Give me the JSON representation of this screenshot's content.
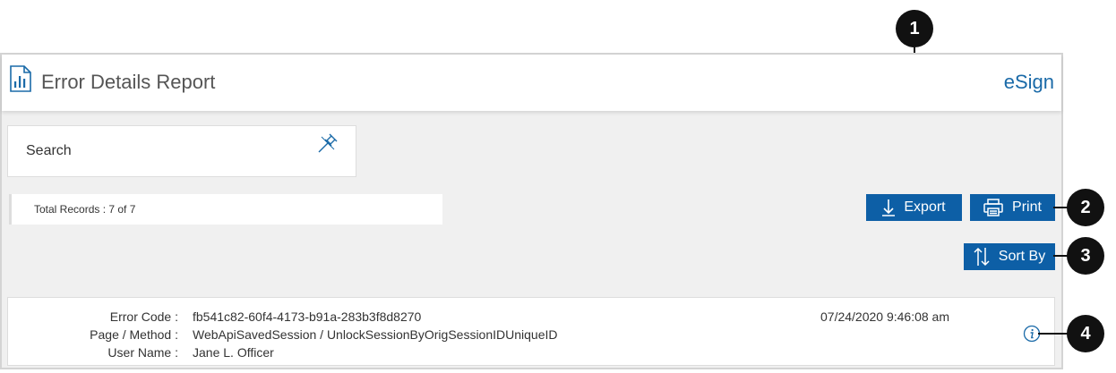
{
  "header": {
    "title": "Error Details Report",
    "brand": "eSign",
    "icon": "bar-chart-report-icon"
  },
  "search": {
    "label": "Search",
    "icon": "pin-icon"
  },
  "records": {
    "total_text": "Total Records : 7 of 7"
  },
  "toolbar": {
    "export_label": "Export",
    "print_label": "Print",
    "sort_label": "Sort By"
  },
  "record": {
    "error_code_label": "Error Code :",
    "error_code": "fb541c82-60f4-4173-b91a-283b3f8d8270",
    "page_method_label": "Page / Method :",
    "page_method": "WebApiSavedSession / UnlockSessionByOrigSessionIDUniqueID",
    "user_name_label": "User Name :",
    "user_name": "Jane L. Officer",
    "timestamp": "07/24/2020 9:46:08 am"
  },
  "callouts": [
    "1",
    "2",
    "3",
    "4"
  ],
  "colors": {
    "accent": "#0d5fa6",
    "brand": "#1a6aa8",
    "background": "#f0f0f0"
  }
}
